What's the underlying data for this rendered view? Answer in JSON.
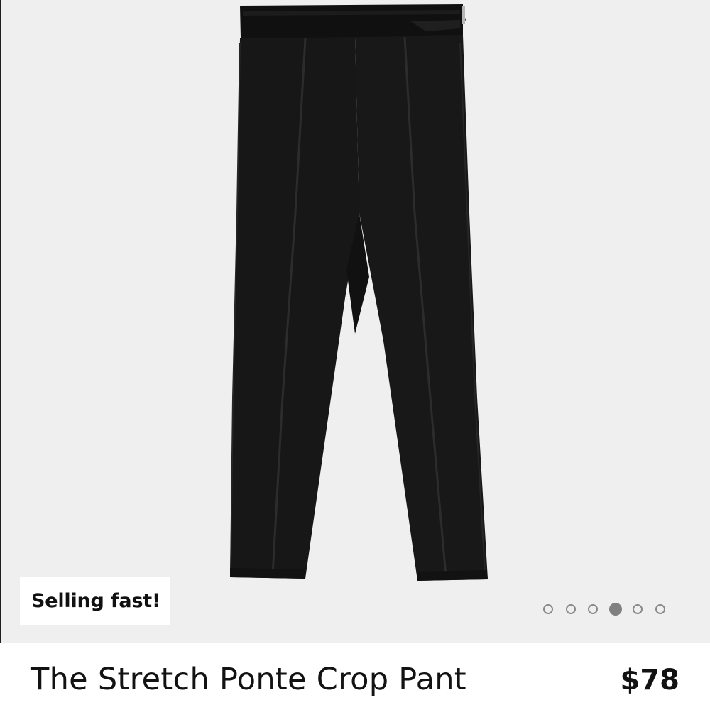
{
  "product": {
    "badge": "Selling fast!",
    "name": "The Stretch Ponte Crop Pant",
    "price": "$78"
  },
  "gallery": {
    "image_description_icon": "pants-image",
    "total_slides": 6,
    "active_slide": 4
  },
  "colors": {
    "background": "#efefef",
    "garment": "#161616",
    "dot": "#8a8a8a"
  }
}
